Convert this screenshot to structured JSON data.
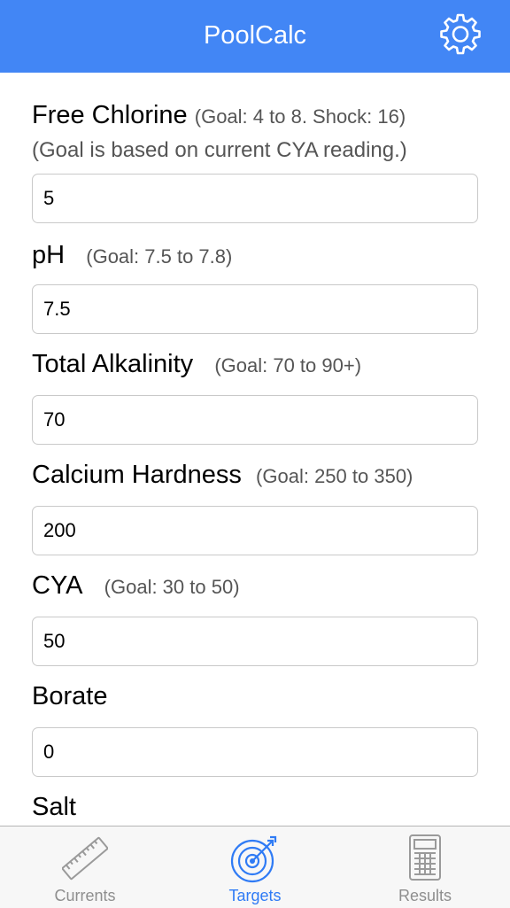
{
  "app": {
    "title": "PoolCalc",
    "accent": "#4286f5",
    "active_tab_color": "#2f7bf5"
  },
  "header": {
    "settings_icon": "gear-icon"
  },
  "form": {
    "free_chlorine": {
      "label": "Free Chlorine",
      "goal": "(Goal: 4 to 8. Shock: 16)",
      "note": "(Goal is based on current CYA reading.)",
      "value": "5"
    },
    "ph": {
      "label": "pH",
      "goal": "(Goal: 7.5 to 7.8)",
      "value": "7.5"
    },
    "total_alkalinity": {
      "label": "Total Alkalinity",
      "goal": "(Goal: 70 to 90+)",
      "value": "70"
    },
    "calcium_hardness": {
      "label": "Calcium Hardness",
      "goal": "(Goal: 250 to 350)",
      "value": "200"
    },
    "cya": {
      "label": "CYA",
      "goal": "(Goal: 30 to 50)",
      "value": "50"
    },
    "borate": {
      "label": "Borate",
      "value": "0"
    },
    "salt": {
      "label": "Salt"
    }
  },
  "tabbar": {
    "tabs": [
      {
        "label": "Currents",
        "icon": "ruler-icon",
        "active": false
      },
      {
        "label": "Targets",
        "icon": "target-icon",
        "active": true
      },
      {
        "label": "Results",
        "icon": "calculator-icon",
        "active": false
      }
    ]
  }
}
